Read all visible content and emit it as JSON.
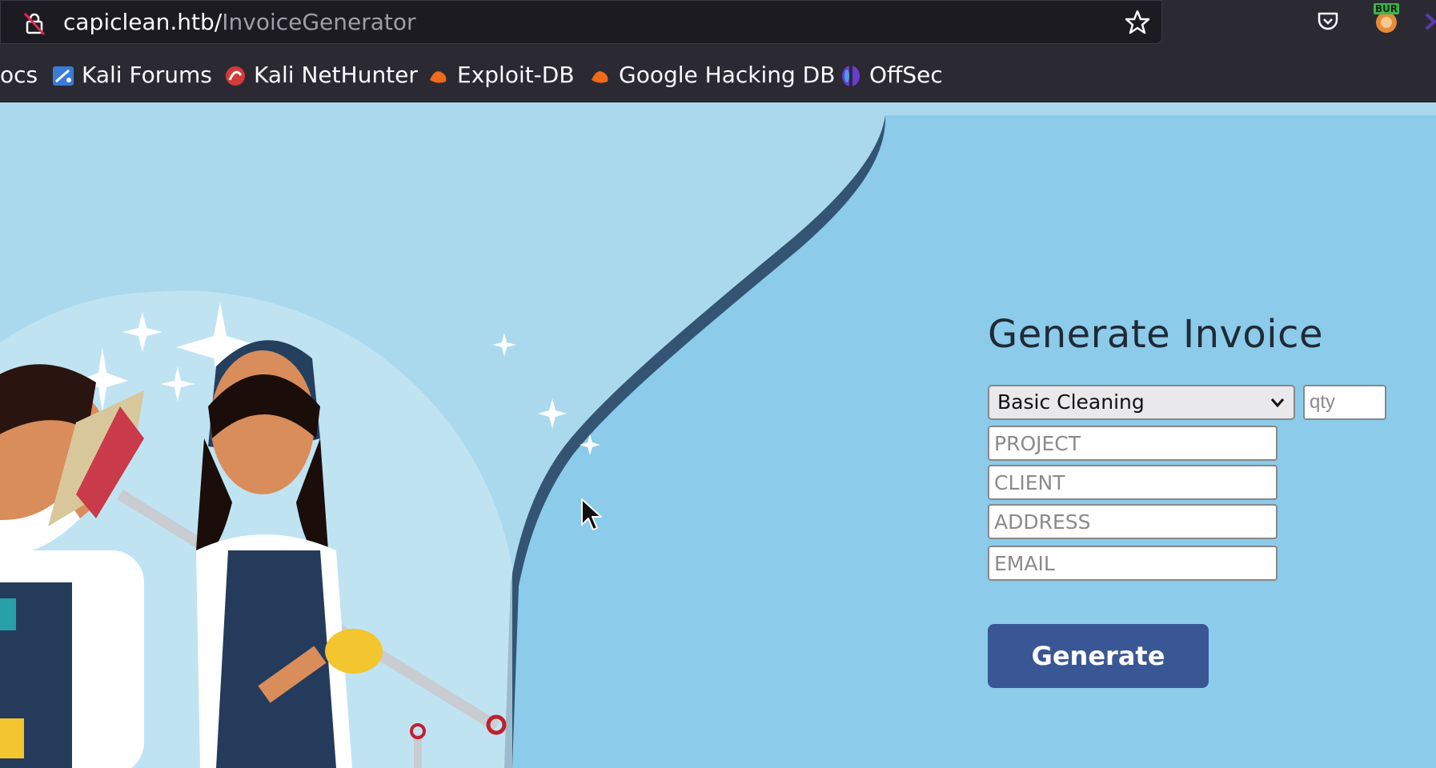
{
  "browser": {
    "url_host": "capiclean.htb/",
    "url_path": "InvoiceGenerator",
    "burp_badge": "BUR"
  },
  "bookmarks": [
    {
      "label": "ocs",
      "icon": "doc-icon"
    },
    {
      "label": "Kali Forums",
      "icon": "kali-forums-icon"
    },
    {
      "label": "Kali NetHunter",
      "icon": "kali-nethunter-icon"
    },
    {
      "label": "Exploit-DB",
      "icon": "exploit-db-icon"
    },
    {
      "label": "Google Hacking DB",
      "icon": "ghdb-icon"
    },
    {
      "label": "OffSec",
      "icon": "offsec-icon"
    }
  ],
  "form": {
    "title": "Generate Invoice",
    "service_selected": "Basic Cleaning",
    "qty_placeholder": "qty",
    "project_placeholder": "PROJECT",
    "client_placeholder": "CLIENT",
    "address_placeholder": "ADDRESS",
    "email_placeholder": "EMAIL",
    "generate_label": "Generate"
  },
  "colors": {
    "page_bg": "#8ccbea",
    "wave_light": "#aad9ee",
    "button": "#3a5795",
    "title": "#1f2a36"
  }
}
